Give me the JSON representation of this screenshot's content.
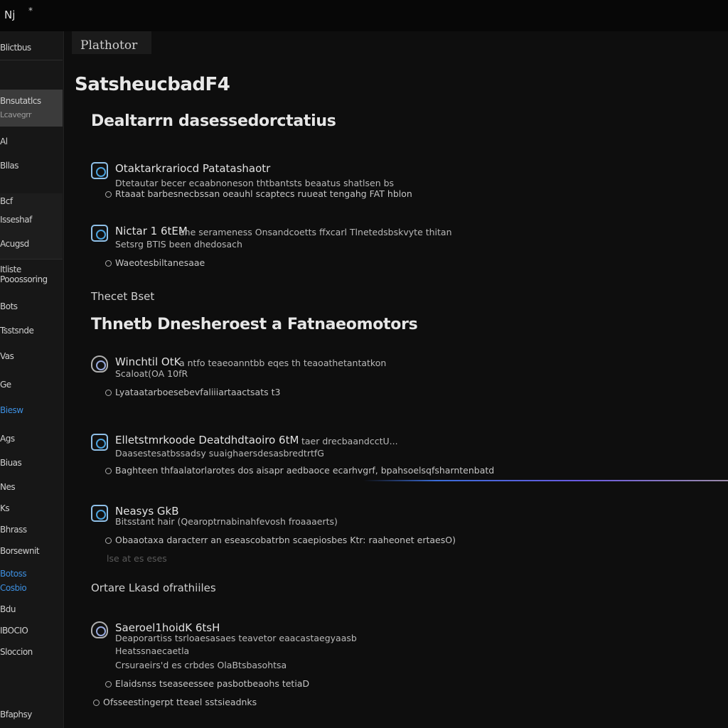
{
  "window": {
    "title": "Nj",
    "title_mark": "*"
  },
  "sidebar": {
    "items": [
      {
        "label": "Blictbus",
        "top": 0
      },
      {
        "label": "Bnsutatlcs",
        "sub": "Lcavegrr"
      },
      {
        "label": "Al"
      },
      {
        "label": "Bllas"
      },
      {
        "label": "Bcf"
      },
      {
        "label": "Isseshaf"
      },
      {
        "label": "Acugsd"
      },
      {
        "label": "Itliste"
      },
      {
        "label": "Pooossoring"
      },
      {
        "label": "Bots"
      },
      {
        "label": "Tsstsnde"
      },
      {
        "label": "Vas"
      },
      {
        "label": "Ge"
      },
      {
        "label": "Biesw"
      },
      {
        "label": "Ags"
      },
      {
        "label": "Biuas"
      },
      {
        "label": "Nes"
      },
      {
        "label": "Ks"
      },
      {
        "label": "Bhrass"
      },
      {
        "label": "Borsewnit"
      },
      {
        "label": "Botoss"
      },
      {
        "label": "Cosbio"
      },
      {
        "label": "Bdu"
      },
      {
        "label": "IBOCIO"
      },
      {
        "label": "Sloccion"
      },
      {
        "label": "Bfaphsy"
      }
    ]
  },
  "main": {
    "tab_label": "Plathotor",
    "page_title": "SatsheucbadF4",
    "heading1": "Dealtarrn dasessedorctatius",
    "section1_entries": [
      {
        "title": "Otaktarkrariocd Patatashaotr",
        "lines": [
          "Dtetautar becer ecaabnoneson thtbantsts beaatus shatlsen bs"
        ],
        "bullets": [
          "Rtaaat barbesnecbssan oeauhl scaptecs ruueat tengahg FAT hblon"
        ]
      },
      {
        "title": "Nictar 1 6tEM",
        "title_tail": "ane serameness Onsandcoetts ffxcarl Tlnetedsbskvyte thitan",
        "lines": [
          "Setsrg BTIS been dhedosach"
        ],
        "bullets": [
          "Waeotesbiltanesaae"
        ]
      }
    ],
    "label2": "Thecet Bset",
    "heading2": "Thnetb Dnesheroest a Fatnaeomotors",
    "section2_entries": [
      {
        "title": "Winchtil OtK",
        "title_tail": "a ntfo teaeoanntbb eqes th teaoathetantatkon",
        "lines": [
          "Scaloat(OA 10fR"
        ],
        "bullets": [
          "Lyataatarboesebevfaliiiartaactsats t3"
        ]
      },
      {
        "title": "Elletstmrkoode Deatdhdtaoiro 6tM",
        "title_tail": "taer drecbaandcctU...",
        "lines": [
          "Daasestesatbssadsy suaighaersdesasbredtrtfG"
        ],
        "bullets": [
          "Baghteen thfaalatorlarotes dos aisapr aedbaoce ecarhvgrf, bpahsoelsqfsharntenbatd"
        ]
      },
      {
        "title": "Neasys GkB",
        "lines": [
          "Bitsstant hair (Qearoptrnabinahfevosh froaaaerts)"
        ],
        "bullets": [
          "Obaaotaxa daracterr an eseascobatrbn scaepiosbes Ktr: raaheonet ertaesO)"
        ],
        "extra": "lse at es eses"
      }
    ],
    "label3": "Ortare Lkasd ofrathiiles",
    "section3_entries": [
      {
        "title": "Saeroel1hoidK 6tsH",
        "lines": [
          "Deaporartiss tsrloaesasaes teavetor eaacastaegyaasb",
          "Heatssnaecaetla",
          "Crsuraeirs'd es crbdes OlaBtsbasohtsa"
        ],
        "bullets": [
          "Elaidsnss tseaseessee pasbotbeaohs tetiaD"
        ]
      }
    ],
    "footer_bullet": "Ofsseestingerpt tteael sstsieadnks"
  }
}
